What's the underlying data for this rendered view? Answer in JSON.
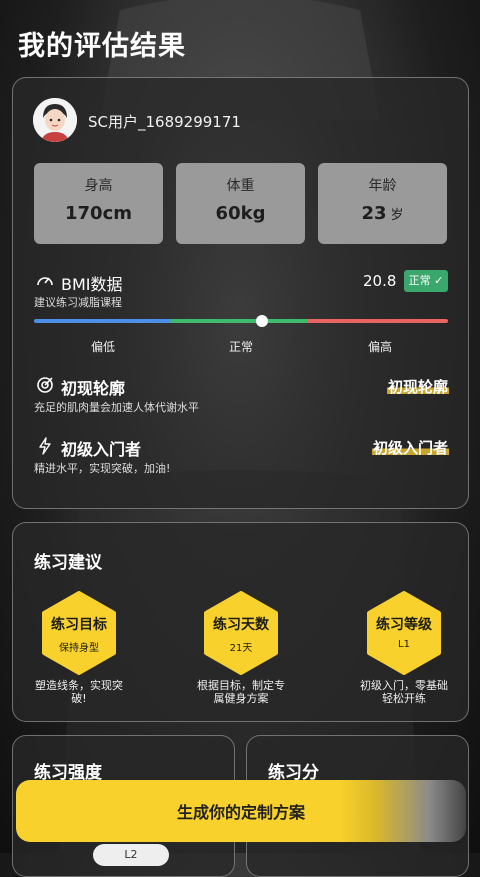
{
  "header": {
    "title": "我的评估结果"
  },
  "profile": {
    "username": "SC用户_1689299171",
    "stats": [
      {
        "label": "身高",
        "value": "170cm",
        "unit": ""
      },
      {
        "label": "体重",
        "value": "60kg",
        "unit": ""
      },
      {
        "label": "年龄",
        "value": "23",
        "unit": "岁"
      }
    ],
    "bmi": {
      "title": "BMI数据",
      "subtitle": "建议练习减脂课程",
      "value": "20.8",
      "badge": "正常",
      "scale": [
        "偏低",
        "正常",
        "偏高"
      ],
      "position_fraction": 0.55
    },
    "rows": [
      {
        "icon": "target-icon",
        "title": "初现轮廓",
        "subtitle": "充足的肌肉量会加速人体代谢水平",
        "tag": "初现轮廓"
      },
      {
        "icon": "lightning-icon",
        "title": "初级入门者",
        "subtitle": "精进水平，实现突破，加油!",
        "tag": "初级入门者"
      }
    ]
  },
  "advice": {
    "title": "练习建议",
    "items": [
      {
        "label": "练习目标",
        "value": "保持身型",
        "desc": "塑造线条，实现突破!"
      },
      {
        "label": "练习天数",
        "value": "21天",
        "desc": "根据目标，制定专属健身方案"
      },
      {
        "label": "练习等级",
        "value": "L1",
        "desc": "初级入门，零基础轻松开练"
      }
    ]
  },
  "bottom_cards": {
    "intensity_title": "练习强度",
    "split_title": "练习分",
    "peek_label": "L2"
  },
  "cta": {
    "label": "生成你的定制方案"
  },
  "colors": {
    "accent": "#f9d12c",
    "normal_badge": "#3aa76d",
    "low": "#4d8fe8",
    "mid": "#3ebc6b",
    "high": "#e96363"
  }
}
